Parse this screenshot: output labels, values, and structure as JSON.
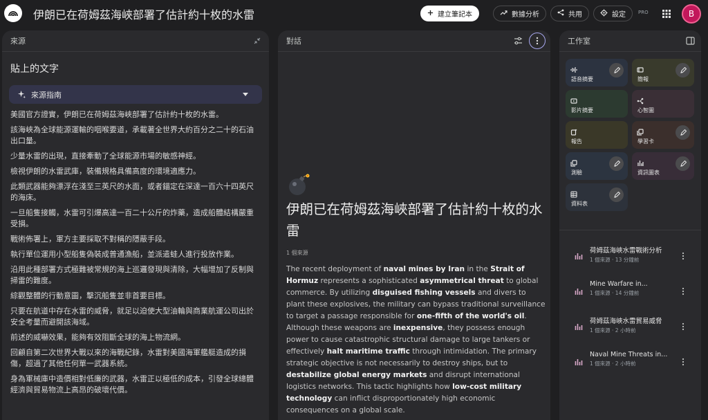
{
  "header": {
    "title": "伊朗已在荷姆茲海峽部署了估計約十枚的水雷",
    "create_notebook": "建立筆記本",
    "analytics": "數據分析",
    "share": "共用",
    "settings": "設定",
    "pro": "PRO",
    "avatar_initial": "B"
  },
  "sources": {
    "header": "來源",
    "subtitle": "貼上的文字",
    "guide_label": "來源指南",
    "paragraphs": [
      "美國官方證實，伊朗已在荷姆茲海峽部署了估計約十枚的水雷。",
      "該海峽為全球能源運輸的咽喉要道，承載著全世界大約百分之二十的石油出口量。",
      "少量水雷的出現，直接牽動了全球能源市場的敏感神經。",
      "檢視伊朗的水雷武庫，裝備規格具備高度的環境適應力。",
      "此類武器能夠漂浮在淺至三英尺的水面，或者錨定在深達一百六十四英尺的海床。",
      "一旦船隻接觸，水雷可引爆高達一百二十公斤的炸藥，造成船體結構嚴重受損。",
      "戰術佈署上，軍方主要採取不對稱的隱蔽手段。",
      "執行單位運用小型船隻偽裝成普通漁船，並派遣蛙人進行投放作業。",
      "沿用此種部署方式極難被常規的海上巡邏發現與清除，大幅增加了反制與掃雷的難度。",
      "綜觀整體的行動意圖，擊沉船隻並非首要目標。",
      "只要在航道中存在水雷的威脅，就足以迫使大型油輪與商業航運公司出於安全考量而避開該海域。",
      "前述的威嚇效果，能夠有效阻斷全球的海上物流網。",
      "回顧自第二次世界大戰以來的海戰紀錄，水雷對美國海軍艦艇造成的損傷，超過了其他任何單一武器系統。",
      "身為軍械庫中造價相對低廉的武器，水雷正以極低的成本，引發全球總體經濟與貿易物流上高昂的破壞代價。"
    ]
  },
  "chat": {
    "header": "對話",
    "title": "伊朗已在荷姆茲海峽部署了估計約十枚的水雷",
    "source_count": "1 個來源",
    "summary_segments": [
      {
        "t": "The recent deployment of ",
        "b": false
      },
      {
        "t": "naval mines by Iran",
        "b": true
      },
      {
        "t": " in the ",
        "b": false
      },
      {
        "t": "Strait of Hormuz",
        "b": true
      },
      {
        "t": " represents a sophisticated ",
        "b": false
      },
      {
        "t": "asymmetrical threat",
        "b": true
      },
      {
        "t": " to global commerce. By utilizing ",
        "b": false
      },
      {
        "t": "disguised fishing vessels",
        "b": true
      },
      {
        "t": " and divers to plant these explosives, the military can bypass traditional surveillance to target a passage responsible for ",
        "b": false
      },
      {
        "t": "one-fifth of the world's oil",
        "b": true
      },
      {
        "t": ". Although these weapons are ",
        "b": false
      },
      {
        "t": "inexpensive",
        "b": true
      },
      {
        "t": ", they possess enough power to cause catastrophic structural damage to large tankers or effectively ",
        "b": false
      },
      {
        "t": "halt maritime traffic",
        "b": true
      },
      {
        "t": " through intimidation. The primary strategic objective is not necessarily to destroy ships, but to ",
        "b": false
      },
      {
        "t": "destabilize global energy markets",
        "b": true
      },
      {
        "t": " and disrupt international logistics networks. This tactic highlights how ",
        "b": false
      },
      {
        "t": "low-cost military technology",
        "b": true
      },
      {
        "t": " can inflict disproportionately high economic consequences on a global scale.",
        "b": false
      }
    ]
  },
  "studio": {
    "header": "工作室",
    "tiles": [
      {
        "label": "語音摘要",
        "icon": "audio-waveform-icon",
        "bg": "#2c3340",
        "edit": true
      },
      {
        "label": "簡報",
        "icon": "slides-icon",
        "bg": "#393a2c",
        "edit": true
      },
      {
        "label": "影片摘要",
        "icon": "video-icon",
        "bg": "#2c3a30",
        "edit": false
      },
      {
        "label": "心智圖",
        "icon": "mind-map-icon",
        "bg": "#3a2f36",
        "edit": false
      },
      {
        "label": "報告",
        "icon": "report-icon",
        "bg": "#3a3828",
        "edit": false
      },
      {
        "label": "學習卡",
        "icon": "flashcards-icon",
        "bg": "#3b2f2c",
        "edit": true
      },
      {
        "label": "測驗",
        "icon": "quiz-icon",
        "bg": "#2c3440",
        "edit": true
      },
      {
        "label": "資訊圖表",
        "icon": "infographic-icon",
        "bg": "#382d38",
        "edit": true
      },
      {
        "label": "資料表",
        "icon": "data-table-icon",
        "bg": "#2d323b",
        "edit": true
      }
    ],
    "notes": [
      {
        "title": "荷姆茲海峽水雷戰術分析",
        "meta": "1 個來源 · 13 分鐘前"
      },
      {
        "title": "Mine Warfare in...",
        "meta": "1 個來源 · 14 分鐘前"
      },
      {
        "title": "荷姆茲海峽水雷貿易威脅",
        "meta": "1 個來源 · 2 小時前"
      },
      {
        "title": "Naval Mine Threats in...",
        "meta": "1 個來源 · 2 小時前"
      }
    ]
  },
  "colors": {
    "background": "#1f1f21",
    "panel": "#2a2a2d",
    "accent_avatar": "#c2185b",
    "note_icon": "#d9a8c8"
  }
}
